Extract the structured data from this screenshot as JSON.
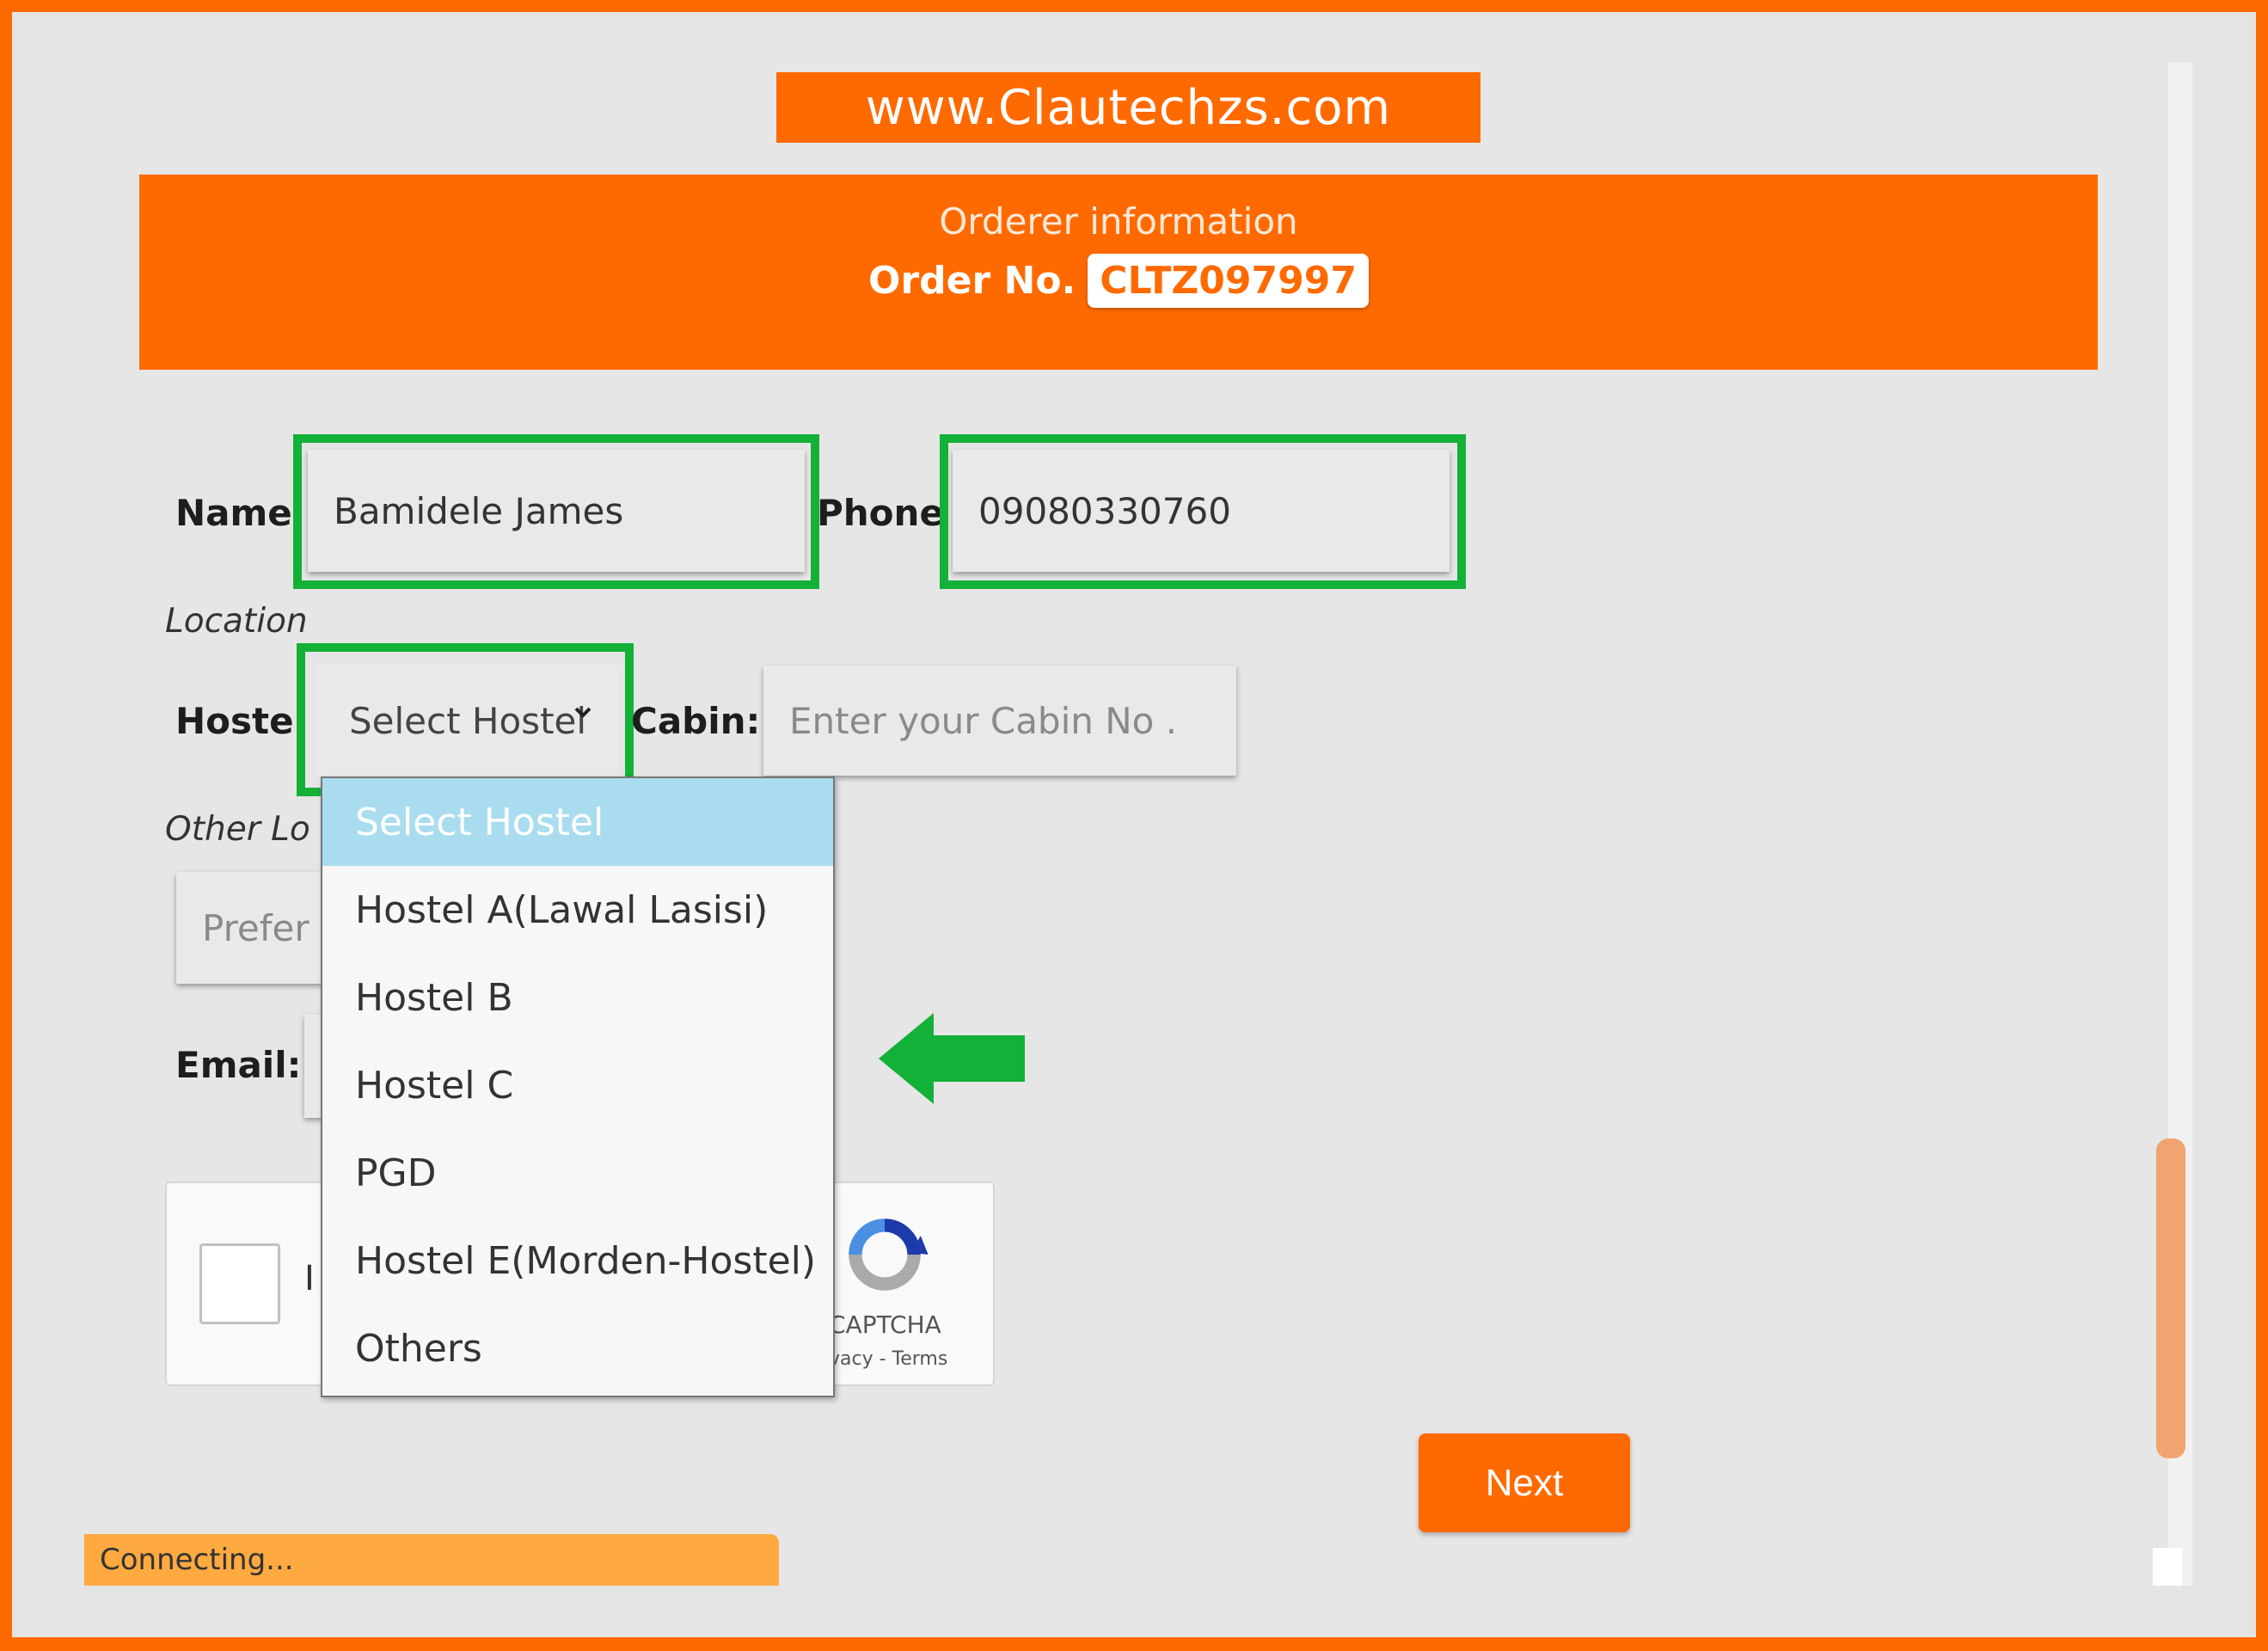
{
  "watermark": "www.Clautechzs.com",
  "header": {
    "subtitle": "Orderer information",
    "order_label": "Order No.",
    "order_number": "CLTZ097997"
  },
  "form": {
    "name_label": "Name",
    "name_value": "Bamidele James",
    "phone_label": "Phone",
    "phone_value": "09080330760",
    "location_label": "Location",
    "hostel_label": "Hostel",
    "hostel_selected": "Select Hostel",
    "cabin_label": "Cabin:",
    "cabin_placeholder": "Enter your Cabin No .",
    "other_location_label": "Other Lo",
    "other_location_placeholder": "Prefer",
    "email_label": "Email:"
  },
  "dropdown": {
    "options": [
      "Select Hostel",
      "Hostel A(Lawal Lasisi)",
      "Hostel B",
      "Hostel C",
      "PGD",
      "Hostel E(Morden-Hostel)",
      "Others"
    ],
    "selected_index": 0
  },
  "captcha": {
    "checkbox_text": "I",
    "brand": "CAPTCHA",
    "links": "vacy - Terms"
  },
  "buttons": {
    "next_label": "Next"
  },
  "status_bar": "Connecting...",
  "colors": {
    "brand_orange": "#ff6a00",
    "highlight_green": "#13b138",
    "dropdown_selected": "#a9dcee"
  },
  "icons": {
    "select_chevron": "chevron-down-icon",
    "annotation_arrow": "arrow-left-icon",
    "recaptcha_logo": "recaptcha-logo-icon"
  }
}
